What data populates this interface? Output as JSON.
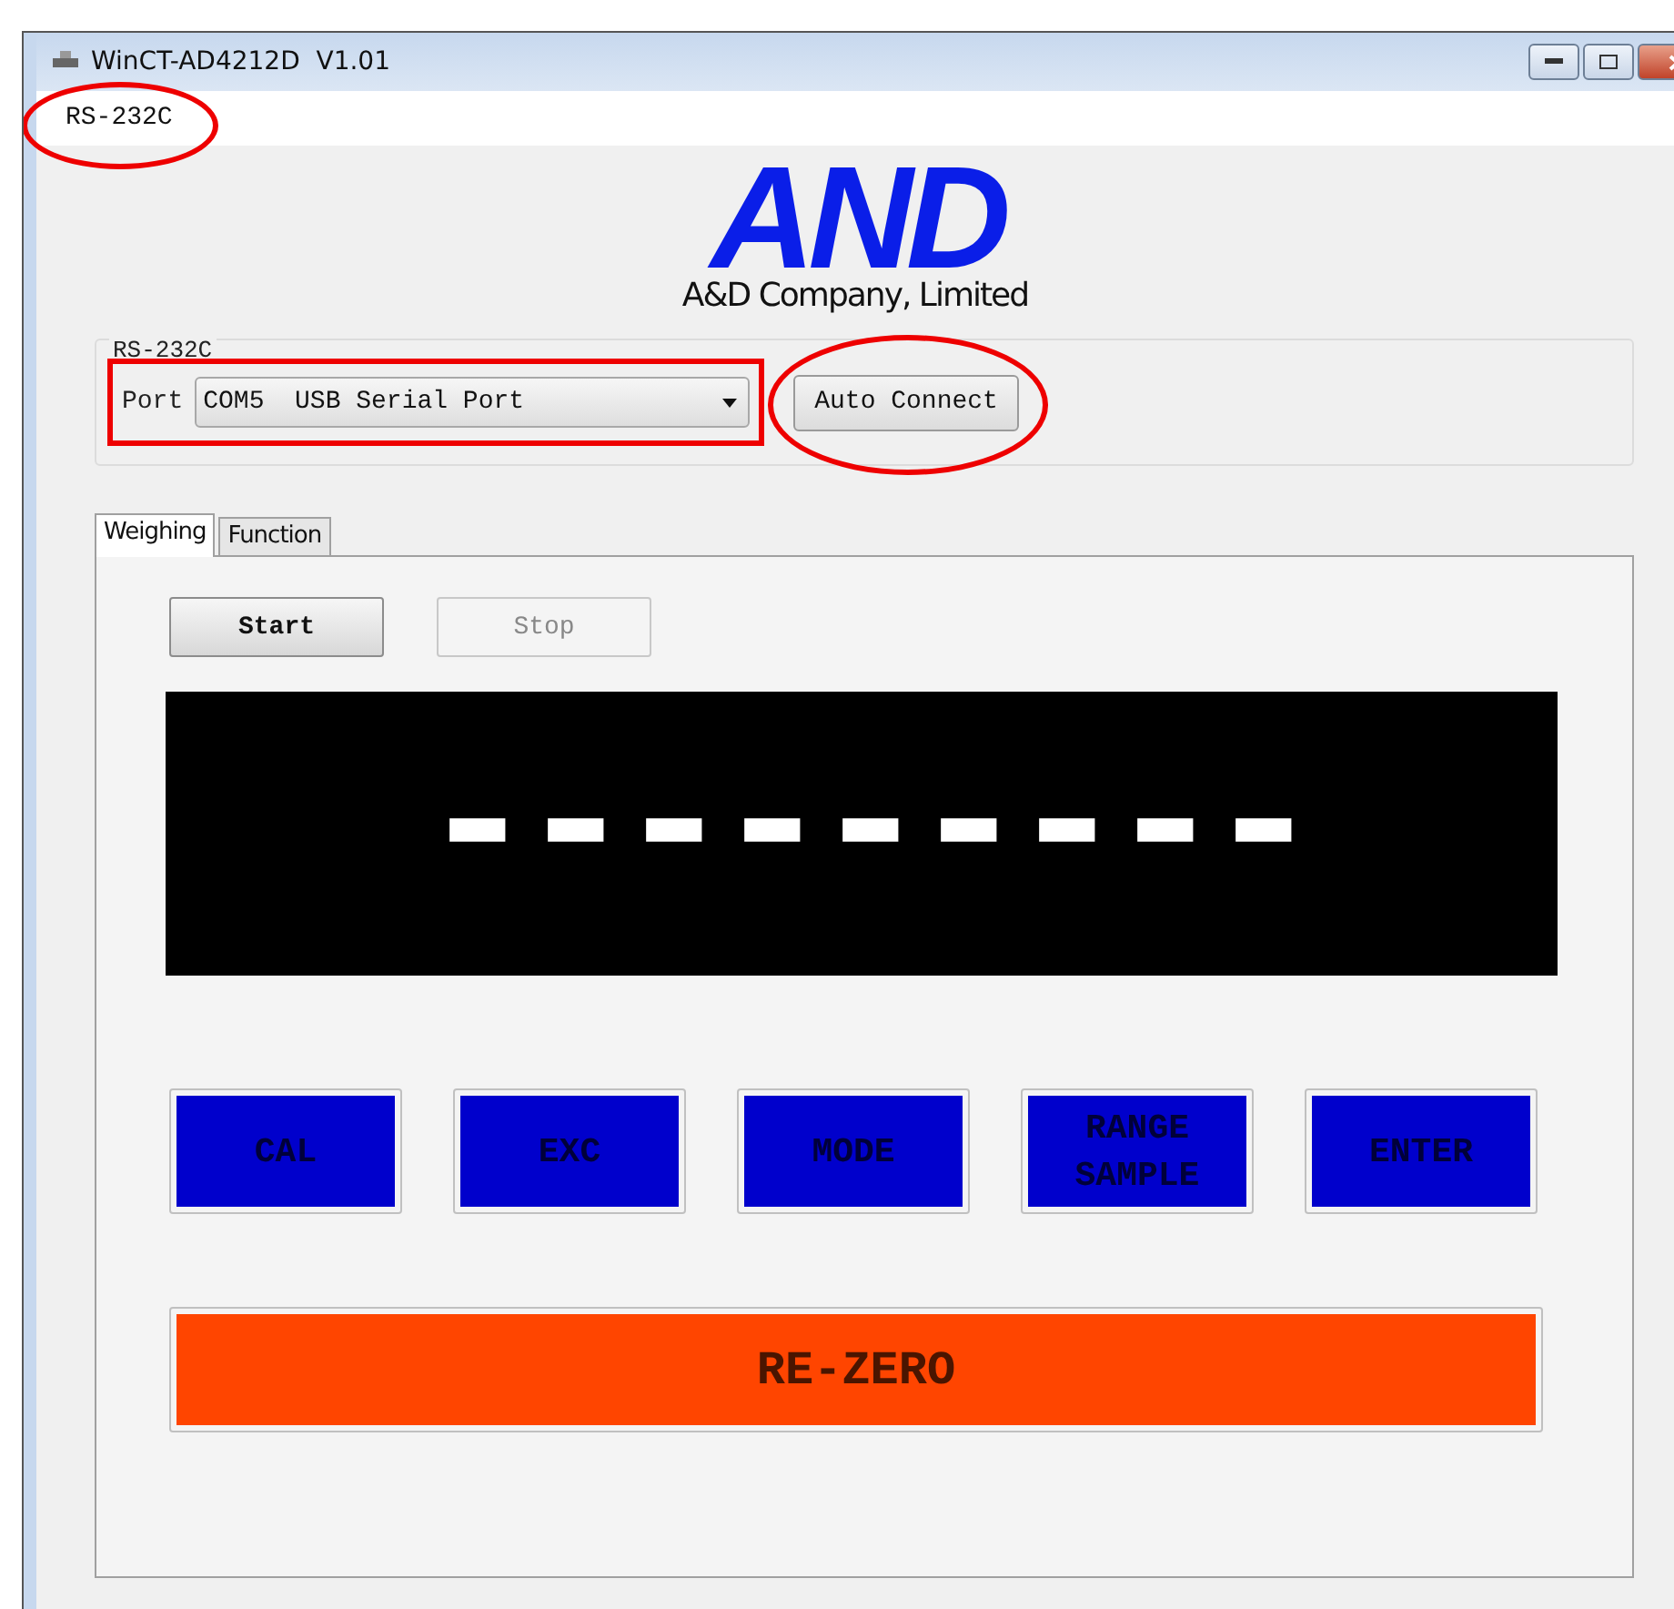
{
  "window": {
    "title": "WinCT-AD4212D  V1.01"
  },
  "menu": [
    {
      "label": "RS-232C",
      "circled": true
    }
  ],
  "logo": {
    "mark": "AND",
    "company": "A&D Company, Limited"
  },
  "rs232c": {
    "title": "RS-232C",
    "port_label": "Port",
    "port_value": "COM5  USB Serial Port",
    "port_boxed": true,
    "auto_connect": {
      "label": "Auto Connect",
      "circled": true
    }
  },
  "tabs": [
    {
      "label": "Weighing",
      "selected": true
    },
    {
      "label": "Function",
      "selected": false
    }
  ],
  "controls": [
    {
      "label": "Start",
      "disabled": false
    },
    {
      "label": "Stop",
      "disabled": true
    }
  ],
  "display": {
    "reading": "---------"
  },
  "keys": [
    {
      "label": "CAL"
    },
    {
      "label": "EXC"
    },
    {
      "label": "MODE"
    },
    {
      "label": "RANGE SAMPLE"
    },
    {
      "label": "ENTER"
    }
  ],
  "rezero": {
    "label": "RE-ZERO"
  }
}
